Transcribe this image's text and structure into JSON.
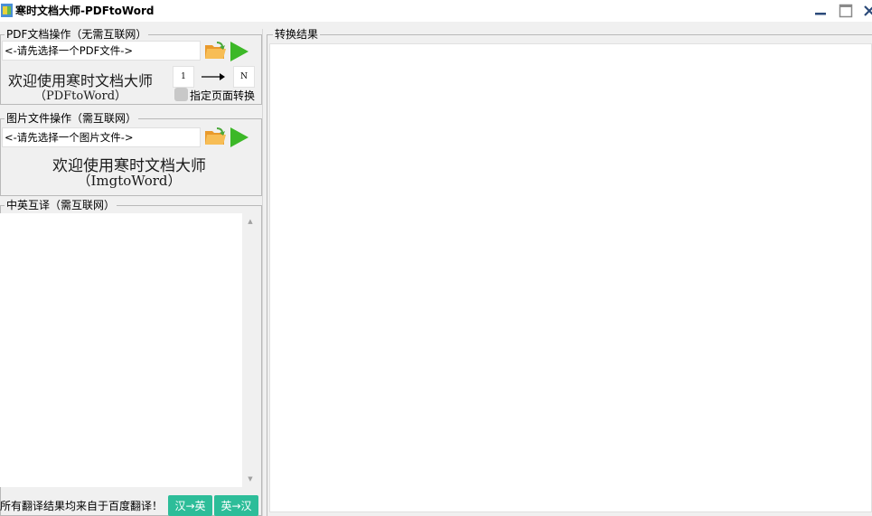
{
  "window": {
    "title": "寒时文档大师-PDFtoWord"
  },
  "pdf_section": {
    "group_title": "PDF文档操作（无需互联网）",
    "file_placeholder": "<-请先选择一个PDF文件->",
    "welcome_line1": "欢迎使用寒时文档大师",
    "welcome_line2": "（PDFtoWord）",
    "page_from": "1",
    "page_to": "N",
    "specify_pages_label": "指定页面转换",
    "specify_pages_checked": false
  },
  "image_section": {
    "group_title": "图片文件操作（需互联网）",
    "file_placeholder": "<-请先选择一个图片文件->",
    "welcome_line1": "欢迎使用寒时文档大师",
    "welcome_line2": "（ImgtoWord）"
  },
  "translate_section": {
    "group_title": "中英互译（需互联网）",
    "text": "",
    "note": "所有翻译结果均来自于百度翻译！",
    "zh_to_en_label": "汉→英",
    "en_to_zh_label": "英→汉"
  },
  "result_section": {
    "group_title": "转换结果",
    "text": ""
  },
  "colors": {
    "accent_green": "#2dbd99",
    "play_green": "#3cb827",
    "folder_orange": "#f2a43a"
  },
  "icons": {
    "open_folder": "folder-open-icon",
    "start": "play-icon",
    "arrow": "arrow-right-icon"
  }
}
